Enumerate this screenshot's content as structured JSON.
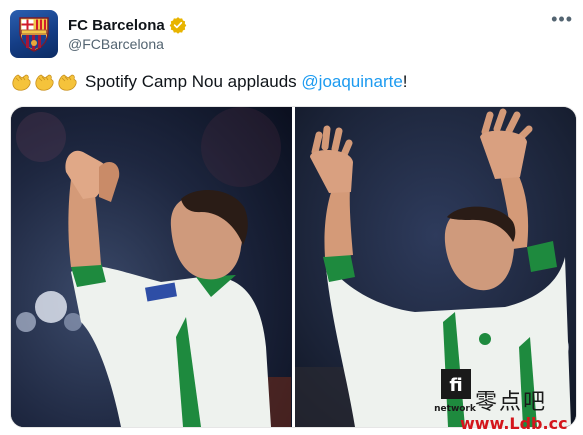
{
  "author": {
    "display_name": "FC Barcelona",
    "handle": "@FCBarcelona",
    "verified_icon": "gold-checkmark-badge",
    "avatar_icon": "fc-barcelona-crest"
  },
  "menu": {
    "more_label": "•••"
  },
  "tweet": {
    "emoji": [
      "👏",
      "👏",
      "👏"
    ],
    "text_prefix": "Spotify Camp Nou applauds ",
    "mention": "@joaquinarte",
    "text_suffix": "!"
  },
  "media": {
    "photos": [
      {
        "description_icon": "player-applauding-photo"
      },
      {
        "description_icon": "player-waving-photo",
        "shirt_text": "network"
      }
    ]
  },
  "watermark": {
    "chinese": "零点吧",
    "url": "www.Ldb.cc"
  },
  "colors": {
    "accent": "#1d9bf0",
    "verified": "#e8b400",
    "watermark_red": "#d4161c"
  }
}
